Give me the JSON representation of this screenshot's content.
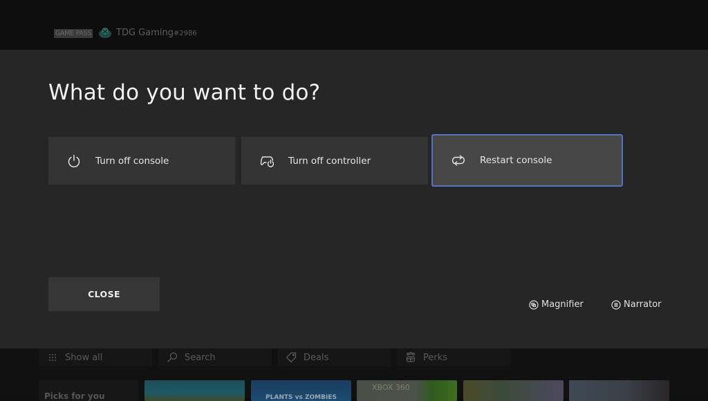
{
  "header": {
    "badge": "GAME PASS",
    "avatar_icon": "xbox-avatar-icon",
    "gamertag": "TDG Gaming",
    "gamertag_suffix": "#2986"
  },
  "dialog": {
    "title": "What do you want to do?",
    "options": [
      {
        "label": "Turn off console",
        "icon": "power-icon",
        "focused": false
      },
      {
        "label": "Turn off controller",
        "icon": "controller-power-icon",
        "focused": false
      },
      {
        "label": "Restart console",
        "icon": "restart-icon",
        "focused": true
      }
    ],
    "close_label": "CLOSE",
    "accessibility": [
      {
        "label": "Magnifier",
        "icon": "magnifier-icon"
      },
      {
        "label": "Narrator",
        "icon": "narrator-icon"
      }
    ],
    "focus_color": "#5a73b4"
  },
  "background": {
    "nav": [
      {
        "label": "Show all",
        "icon": "grid-icon"
      },
      {
        "label": "Search",
        "icon": "search-icon"
      },
      {
        "label": "Deals",
        "icon": "tag-icon"
      },
      {
        "label": "Perks",
        "icon": "gift-icon"
      }
    ],
    "picks_label": "Picks for you",
    "tiles": [
      {
        "name": "game-tile-1",
        "text": ""
      },
      {
        "name": "game-tile-plants-vs-zombies",
        "text": "PLANTS vs ZOMBIES"
      },
      {
        "name": "game-tile-xbox-360",
        "text": "XBOX 360"
      },
      {
        "name": "game-tile-4",
        "text": ""
      },
      {
        "name": "game-tile-5",
        "text": ""
      }
    ]
  }
}
